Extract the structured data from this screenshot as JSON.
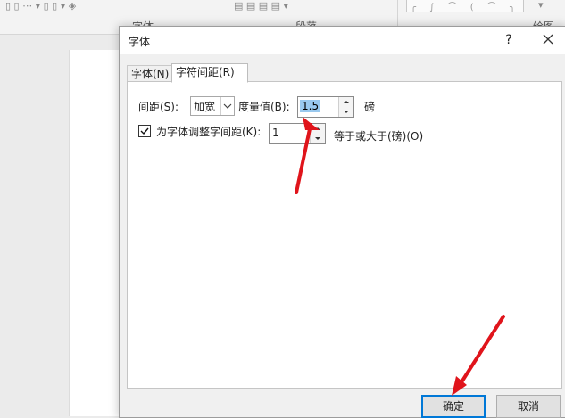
{
  "ribbon": {
    "font_group_label": "字体",
    "paragraph_group_label": "段落",
    "drawing_group_label": "绘图"
  },
  "dialog": {
    "title": "字体",
    "help_label": "?",
    "tabs": [
      {
        "label": "字体(N)",
        "active": false
      },
      {
        "label": "字符间距(R)",
        "active": true
      }
    ],
    "spacing": {
      "label": "间距(S):",
      "value": "加宽",
      "by_label": "度量值(B):",
      "by_value": "1.5",
      "unit": "磅"
    },
    "kerning": {
      "checked": true,
      "label": "为字体调整字间距(K):",
      "value": "1",
      "suffix": "等于或大于(磅)(O)"
    },
    "ok_label": "确定",
    "cancel_label": "取消"
  },
  "annotation_color": "#e0141b"
}
